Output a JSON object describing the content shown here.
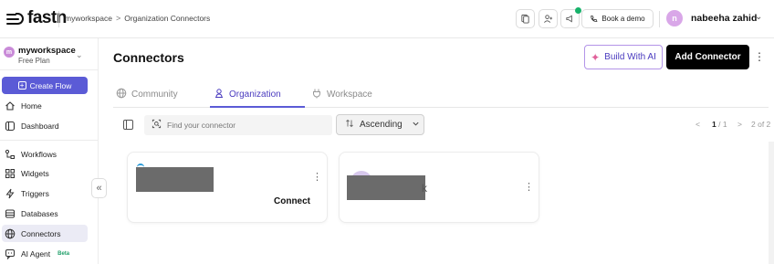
{
  "brand": {
    "logo_text": "fastn"
  },
  "breadcrumb": {
    "workspace": "myworkspace",
    "separator": ">",
    "current": "Organization Connectors"
  },
  "topbar": {
    "demo_label": "Book a demo",
    "user_initial": "n",
    "user_name": "nabeeha zahid",
    "colors": {
      "notif_dot": "#17b26a",
      "avatar": "#d9a7e8"
    }
  },
  "sidebar": {
    "workspace_name": "myworkspace",
    "workspace_plan": "Free Plan",
    "workspace_initial": "m",
    "create_flow_label": "Create Flow",
    "items": [
      {
        "label": "Home",
        "icon": "home-icon"
      },
      {
        "label": "Dashboard",
        "icon": "dashboard-icon"
      },
      {
        "label": "Workflows",
        "icon": "workflow-icon"
      },
      {
        "label": "Widgets",
        "icon": "widgets-icon"
      },
      {
        "label": "Triggers",
        "icon": "lightning-icon"
      },
      {
        "label": "Databases",
        "icon": "database-icon"
      },
      {
        "label": "Connectors",
        "icon": "globe-icon",
        "active": true
      },
      {
        "label": "AI Agent",
        "icon": "chat-icon",
        "badge": "Beta"
      }
    ]
  },
  "main": {
    "title": "Connectors",
    "build_ai_label": "Build With AI",
    "add_connector_label": "Add Connector",
    "tabs": [
      {
        "label": "Community",
        "icon": "globe-icon"
      },
      {
        "label": "Organization",
        "icon": "user-icon",
        "active": true
      },
      {
        "label": "Workspace",
        "icon": "plug-icon"
      }
    ],
    "search_placeholder": "Find your connector",
    "sort_label": "Ascending",
    "pager": {
      "prev": "<",
      "page_current": "1",
      "page_total": "/ 1",
      "next": ">",
      "range": "2 of 2"
    },
    "cards": [
      {
        "action_label": "Connect",
        "name_redacted": true
      },
      {
        "action_label": "",
        "name_redacted": true,
        "name_tail": "k"
      }
    ]
  },
  "theme": {
    "accent": "#5b5bd6",
    "accent_text": "#4a3bbf",
    "ai_border": "#b394e8"
  }
}
